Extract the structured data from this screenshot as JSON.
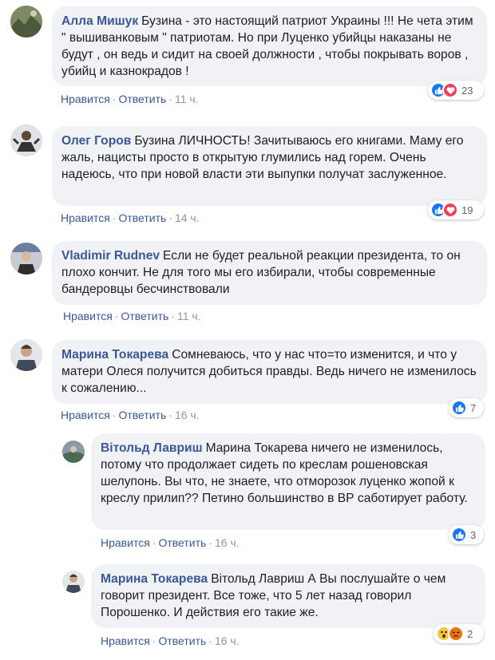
{
  "labels": {
    "like": "Нравится",
    "reply": "Ответить",
    "dot": "·"
  },
  "comments": [
    {
      "author": "Алла Мишук",
      "text": "Бузина - это настоящий патриот Украины !!! Не чета этим \" вышиванковым \" патриотам. Но при Луценко убийцы наказаны не будут , он ведь и сидит на своей должности , чтобы покрывать воров , убийц и казнокрадов !",
      "time": "11 ч.",
      "reactions": [
        "like",
        "love"
      ],
      "count": "23"
    },
    {
      "author": "Олег Горов",
      "text": "Бузина ЛИЧНОСТЬ! Зачитываюсь его книгами. Маму его жаль, нацисты просто в открытую глумились над горем. Очень надеюсь, что при новой власти эти выпупки получат заслуженное.",
      "time": "14 ч.",
      "reactions": [
        "like",
        "love"
      ],
      "count": "19"
    },
    {
      "author": "Vladimir Rudnev",
      "text": "Если не будет реальной реакции президента, то он плохо кончит. Не для того мы его избирали, чтобы современные бандеровцы бесчинствовали",
      "time": "11 ч.",
      "reactions": [],
      "count": ""
    },
    {
      "author": "Марина Токарева",
      "text": "Сомневаюсь, что у нас что=то изменится, и что у матери Олеся получится добиться правды. Ведь ничего не изменилось к сожалению...",
      "time": "16 ч.",
      "reactions": [
        "like"
      ],
      "count": "7"
    },
    {
      "author": "Вітольд Лавриш",
      "text": "Марина Токарева ничего не изменилось, потому что продолжает сидеть по креслам рошеновская шелупонь. Вы что, не знаете, что отморозок луценко жопой к креслу прилип?? Петино большинство в ВР саботирует работу.",
      "time": "16 ч.",
      "reactions": [
        "like"
      ],
      "count": "3"
    },
    {
      "author": "Марина Токарева",
      "text": "Вітольд Лавриш А Вы послушайте о чем говорит президент. Все тоже, что 5 лет назад говорил Порошенко. И действия его такие же.",
      "time": "16 ч.",
      "reactions": [
        "wow",
        "angry"
      ],
      "count": "2"
    }
  ],
  "colors": {
    "link": "#385898",
    "bubble": "#f0f2f5",
    "like": "#1877f2",
    "love": "#f33e58"
  }
}
